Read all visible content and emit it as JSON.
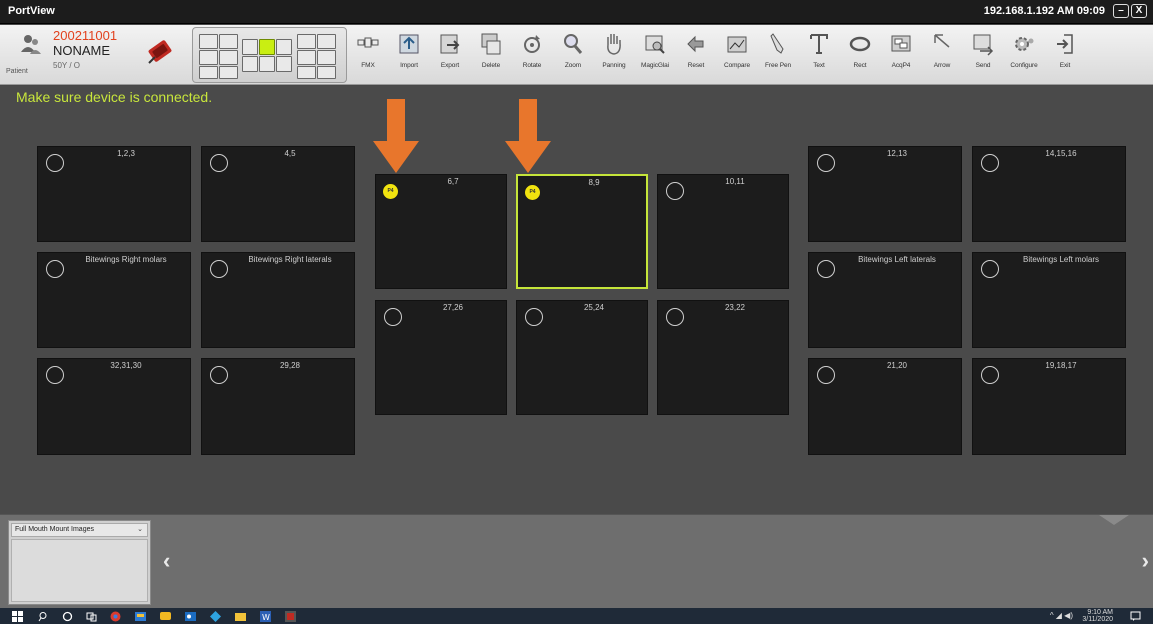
{
  "title_bar": {
    "app_name": "PortView",
    "ip_time": "192.168.1.192  AM 09:09",
    "minimize": "–",
    "close": "X"
  },
  "patient": {
    "label": "Patient",
    "id": "200211001",
    "name": "NONAME",
    "age_sex": "50Y / O"
  },
  "toolbar": {
    "tools": [
      {
        "label": "FMX",
        "icon": "fmx-icon"
      },
      {
        "label": "Import",
        "icon": "import-icon"
      },
      {
        "label": "Export",
        "icon": "export-icon"
      },
      {
        "label": "Delete",
        "icon": "delete-icon"
      },
      {
        "label": "Rotate",
        "icon": "rotate-icon"
      },
      {
        "label": "Zoom",
        "icon": "zoom-icon"
      },
      {
        "label": "Panning",
        "icon": "panning-icon"
      },
      {
        "label": "MagicGlai",
        "icon": "magic-glass-icon"
      },
      {
        "label": "Reset",
        "icon": "reset-icon"
      },
      {
        "label": "Compare",
        "icon": "compare-icon"
      },
      {
        "label": "Free Pen",
        "icon": "free-pen-icon"
      },
      {
        "label": "Text",
        "icon": "text-icon"
      },
      {
        "label": "Rect",
        "icon": "rect-icon"
      },
      {
        "label": "AcqP4",
        "icon": "acqp4-icon"
      },
      {
        "label": "Arrow",
        "icon": "arrow-icon"
      },
      {
        "label": "Send",
        "icon": "send-icon"
      },
      {
        "label": "Configure",
        "icon": "configure-icon"
      },
      {
        "label": "Exit",
        "icon": "exit-icon"
      }
    ]
  },
  "status_message": "Make sure device is connected.",
  "tiles": {
    "t_1_2_3": {
      "label": "1,2,3"
    },
    "t_4_5": {
      "label": "4,5"
    },
    "t_6_7": {
      "label": "6,7",
      "badge": "P4"
    },
    "t_8_9": {
      "label": "8,9",
      "badge": "P4"
    },
    "t_10_11": {
      "label": "10,11"
    },
    "t_12_13": {
      "label": "12,13"
    },
    "t_14_15_16": {
      "label": "14,15,16"
    },
    "t_bw_r_molars": {
      "label": "Bitewings Right molars"
    },
    "t_bw_r_laterals": {
      "label": "Bitewings Right laterals"
    },
    "t_bw_l_laterals": {
      "label": "Bitewings Left laterals"
    },
    "t_bw_l_molars": {
      "label": "Bitewings Left molars"
    },
    "t_27_26": {
      "label": "27,26"
    },
    "t_25_24": {
      "label": "25,24"
    },
    "t_23_22": {
      "label": "23,22"
    },
    "t_32_31_30": {
      "label": "32,31,30"
    },
    "t_29_28": {
      "label": "29,28"
    },
    "t_21_20": {
      "label": "21,20"
    },
    "t_19_18_17": {
      "label": "19,18,17"
    }
  },
  "bottom_panel": {
    "mount_select": "Full Mouth Mount Images",
    "nav_prev": "‹",
    "nav_next": "›"
  },
  "taskbar": {
    "time": "9:10 AM",
    "date": "3/11/2020"
  },
  "colors": {
    "accent": "#c5e53a",
    "badge": "#f1e30f",
    "arrow": "#e8762c",
    "patient_id": "#e2421e"
  }
}
